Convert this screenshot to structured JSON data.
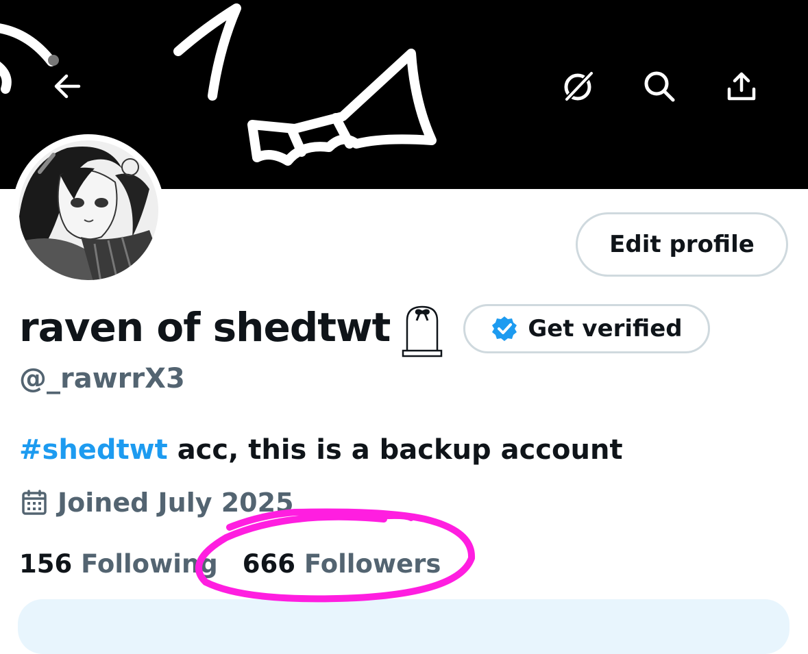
{
  "header": {
    "back_icon": "arrow-left-icon",
    "actions": [
      "grok-icon",
      "search-icon",
      "share-icon"
    ]
  },
  "profile": {
    "edit_label": "Edit profile",
    "display_name": "raven of shedtwt",
    "verify_label": "Get verified",
    "handle": "@_rawrrX3",
    "bio_hashtag": "#shedtwt",
    "bio_text": " acc, this is a backup account",
    "joined": "Joined July 2025",
    "following_count": "156",
    "following_label": "Following",
    "followers_count": "666",
    "followers_label": "Followers"
  },
  "colors": {
    "accent": "#1d9bf0",
    "secondary_text": "#536471",
    "highlight_marker": "#ff1ee0"
  }
}
